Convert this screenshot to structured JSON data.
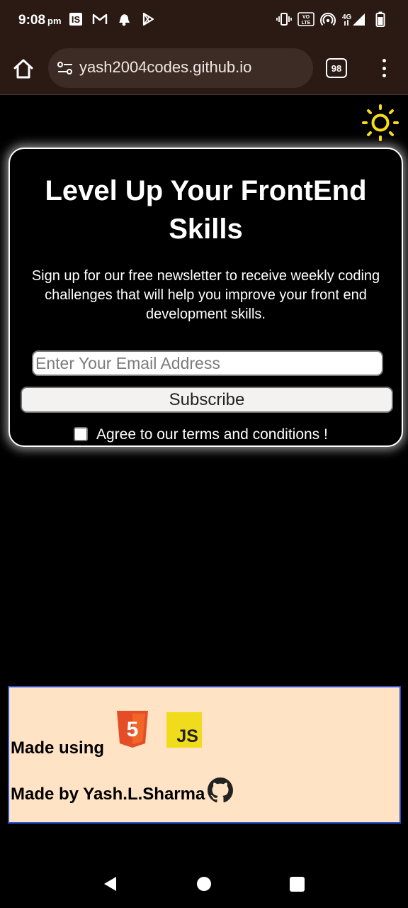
{
  "status_bar": {
    "time": "9:08",
    "ampm": "pm",
    "left_icons": [
      "instasave-icon",
      "gmail-icon",
      "notification-bell-icon",
      "play-store-icon"
    ],
    "right_icons": [
      "vibrate-icon",
      "volte-icon",
      "hotspot-icon",
      "signal-4g-icon",
      "battery-icon"
    ],
    "network_label": "4G",
    "volte_label": "VO LTE"
  },
  "browser": {
    "url": "yash2004codes.github.io",
    "tab_count": "98"
  },
  "newsletter": {
    "title": "Level Up Your FrontEnd Skills",
    "description": "Sign up for our free newsletter to receive weekly coding challenges that will help you improve your front end development skills.",
    "email_placeholder": "Enter Your Email Address",
    "subscribe_label": "Subscribe",
    "terms_label": "Agree to our terms and conditions !",
    "terms_checked": false
  },
  "footer": {
    "made_using_label": "Made using",
    "made_by_label": "Made by Yash.L.Sharma",
    "html5_badge": "5",
    "js_badge": "JS"
  },
  "colors": {
    "chrome_bar": "#2a1a13",
    "footer_bg": "#ffe3c4",
    "footer_border": "#2b50c6",
    "sun_icon": "#f5dd1a",
    "html5_orange": "#e44d26",
    "js_yellow": "#f0db1c"
  }
}
